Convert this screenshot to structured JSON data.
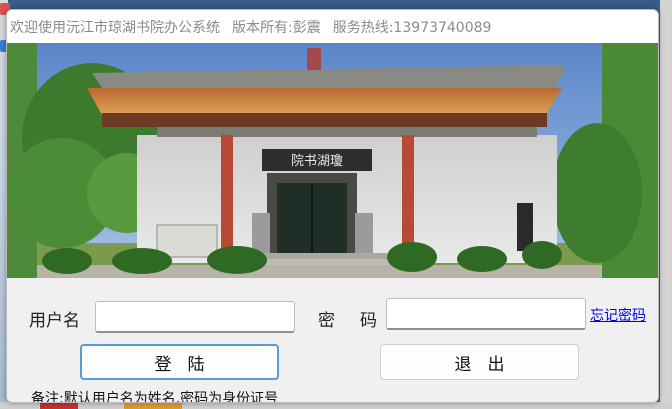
{
  "window": {
    "title_parts": [
      "欢迎使用沅江市琼湖书院办公系统",
      "版本所有:彭震",
      "服务热线:13973740089"
    ]
  },
  "banner": {
    "image_name": "academy-building-photo",
    "plaque_text": "院书湖瓊"
  },
  "form": {
    "username_label": "用户名",
    "username_value": "",
    "password_label": "密　码",
    "password_value": "",
    "forgot_link": "忘记密码",
    "login_button": "登陆",
    "exit_button": "退出",
    "note": "备注:默认用户名为姓名,密码为身份证号"
  },
  "colors": {
    "accent_border": "#5b9bd5",
    "link": "#0000ee",
    "title_text": "#8a8a8a"
  }
}
